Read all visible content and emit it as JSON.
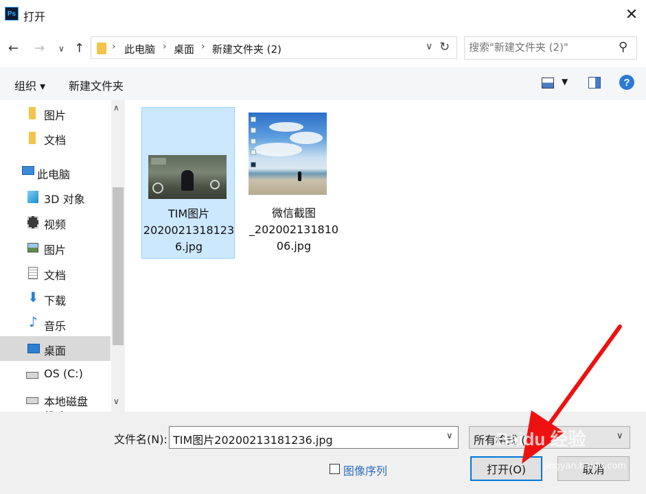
{
  "window": {
    "title": "打开",
    "app_icon_text": "Ps"
  },
  "nav": {
    "breadcrumbs": [
      "此电脑",
      "桌面",
      "新建文件夹 (2)"
    ],
    "search_placeholder": "搜索\"新建文件夹 (2)\""
  },
  "toolbar": {
    "organize": "组织 ▾",
    "new_folder": "新建文件夹"
  },
  "sidebar": {
    "items": [
      {
        "label": "图片",
        "icon": "folder-icon"
      },
      {
        "label": "文档",
        "icon": "folder-icon"
      },
      {
        "label": "此电脑",
        "icon": "computer-icon"
      },
      {
        "label": "3D 对象",
        "icon": "cube-icon"
      },
      {
        "label": "视频",
        "icon": "film-icon"
      },
      {
        "label": "图片",
        "icon": "pictures-icon"
      },
      {
        "label": "文档",
        "icon": "document-icon"
      },
      {
        "label": "下载",
        "icon": "download-icon"
      },
      {
        "label": "音乐",
        "icon": "music-icon"
      },
      {
        "label": "桌面",
        "icon": "desktop-icon",
        "active": true
      },
      {
        "label": "OS (C:)",
        "icon": "drive-icon"
      },
      {
        "label": "本地磁盘 (D:)",
        "icon": "drive-icon"
      }
    ]
  },
  "files": [
    {
      "lines": [
        "TIM图片",
        "2020021318123",
        "6.jpg"
      ],
      "selected": true
    },
    {
      "lines": [
        "微信截图",
        "_202002131810",
        "06.jpg"
      ],
      "selected": false
    }
  ],
  "bottom": {
    "filename_label": "文件名(N):",
    "filename_value": "TIM图片20200213181236.jpg",
    "filetype_value": "所有格式 (*",
    "image_sequence_label": "图像序列",
    "open_button": "打开(O)",
    "cancel_button": "取消"
  },
  "watermark": {
    "text": "Baidu 经验",
    "sub": "jingyan.baidu.com"
  },
  "colors": {
    "selection": "#cce8ff",
    "annotation_arrow": "#ee1111",
    "primary_border": "#0078d7"
  }
}
